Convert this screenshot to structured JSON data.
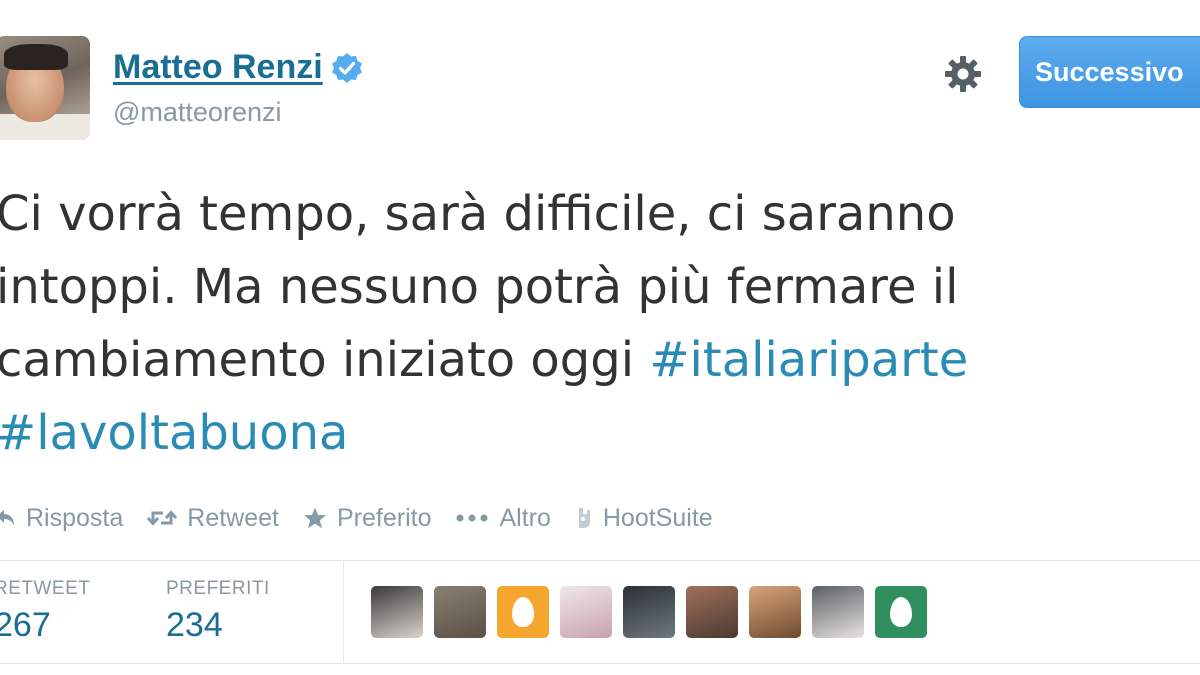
{
  "header": {
    "display_name": "Matteo Renzi",
    "handle": "@matteorenzi",
    "verified": true,
    "follow_button_label": "Successivo"
  },
  "tweet": {
    "lines": [
      "Ci vorrà tempo, sarà difficile, ci saranno",
      "intoppi. Ma nessuno potrà più fermare il",
      "cambiamento iniziato oggi "
    ],
    "hashtags": [
      "#italiariparte",
      "#lavoltabuona"
    ]
  },
  "actions": [
    {
      "label": "Risposta",
      "icon": "reply-icon"
    },
    {
      "label": "Retweet",
      "icon": "retweet-icon"
    },
    {
      "label": "Preferito",
      "icon": "star-icon"
    },
    {
      "label": "Altro",
      "icon": "more-dots-icon"
    },
    {
      "label": "HootSuite",
      "icon": "hootsuite-icon"
    }
  ],
  "stats": {
    "retweet_label": "RETWEET",
    "retweet_count": "267",
    "favorites_label": "PREFERITI",
    "favorites_count": "234"
  },
  "faces": [
    {
      "type": "photo",
      "colors": [
        "#3a3a3a",
        "#d9d4cc"
      ]
    },
    {
      "type": "photo",
      "colors": [
        "#8a7f72",
        "#5b5046"
      ]
    },
    {
      "type": "egg",
      "colors": [
        "#f4a62e",
        "#f4a62e"
      ]
    },
    {
      "type": "photo",
      "colors": [
        "#f0e6ea",
        "#c8a2ae"
      ]
    },
    {
      "type": "photo",
      "colors": [
        "#2b3035",
        "#6f7780"
      ]
    },
    {
      "type": "photo",
      "colors": [
        "#a0705a",
        "#4a3a32"
      ]
    },
    {
      "type": "photo",
      "colors": [
        "#d9a57b",
        "#6e4a2f"
      ]
    },
    {
      "type": "photo",
      "colors": [
        "#5a5f66",
        "#e8e4df"
      ]
    },
    {
      "type": "egg",
      "colors": [
        "#2f8f5e",
        "#2f8f5e"
      ]
    }
  ],
  "colors": {
    "link": "#1a6e93",
    "hashtag": "#2a8bb4",
    "muted": "#8899a6",
    "follow_button": "#4aa1e8",
    "verified_badge": "#55acee"
  }
}
